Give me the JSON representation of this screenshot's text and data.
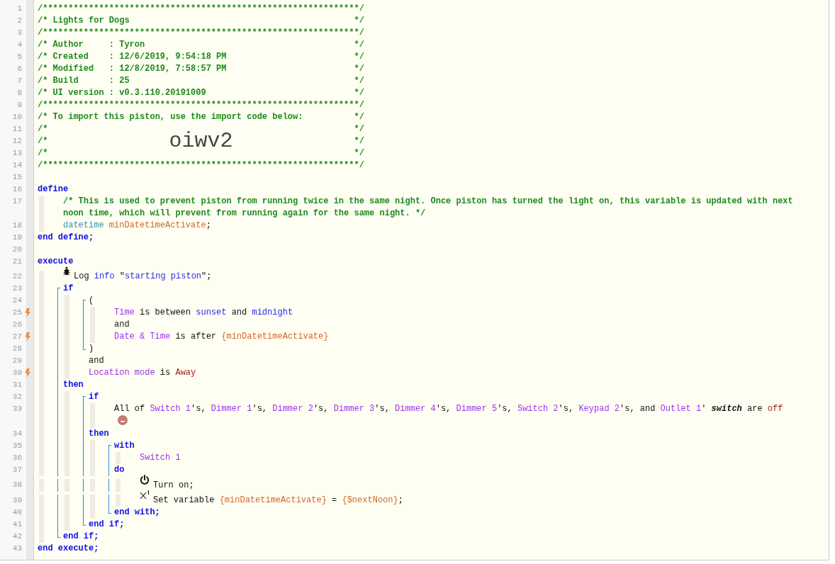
{
  "lines": [
    {
      "number": "1",
      "kind": "banner",
      "bolt": false,
      "bracket_open": false,
      "bracket_close": false,
      "tokens": [
        {
          "text": "/**************************************************************/",
          "kind": "comment"
        }
      ]
    },
    {
      "number": "2",
      "kind": "banner",
      "bolt": false,
      "bracket_open": false,
      "bracket_close": false,
      "tokens": [
        {
          "text": "/* Lights for Dogs",
          "kind": "comment"
        },
        {
          "text": "*/",
          "kind": "comment"
        }
      ]
    },
    {
      "number": "3",
      "kind": "banner",
      "bolt": false,
      "bracket_open": false,
      "bracket_close": false,
      "tokens": [
        {
          "text": "/**************************************************************/",
          "kind": "comment"
        }
      ]
    },
    {
      "number": "4",
      "kind": "banner",
      "bolt": false,
      "bracket_open": false,
      "bracket_close": false,
      "tokens": [
        {
          "text": "/* Author     : Tyron",
          "kind": "comment"
        },
        {
          "text": "*/",
          "kind": "comment"
        }
      ]
    },
    {
      "number": "5",
      "kind": "banner",
      "bolt": false,
      "bracket_open": false,
      "bracket_close": false,
      "tokens": [
        {
          "text": "/* Created    : 12/6/2019, 9:54:18 PM",
          "kind": "comment"
        },
        {
          "text": "*/",
          "kind": "comment"
        }
      ]
    },
    {
      "number": "6",
      "kind": "banner",
      "bolt": false,
      "bracket_open": false,
      "bracket_close": false,
      "tokens": [
        {
          "text": "/* Modified   : 12/8/2019, 7:58:57 PM",
          "kind": "comment"
        },
        {
          "text": "*/",
          "kind": "comment"
        }
      ]
    },
    {
      "number": "7",
      "kind": "banner",
      "bolt": false,
      "bracket_open": false,
      "bracket_close": false,
      "tokens": [
        {
          "text": "/* Build      : 25",
          "kind": "comment"
        },
        {
          "text": "*/",
          "kind": "comment"
        }
      ]
    },
    {
      "number": "8",
      "kind": "banner",
      "bolt": false,
      "bracket_open": false,
      "bracket_close": false,
      "tokens": [
        {
          "text": "/* UI version : v0.3.110.20191009",
          "kind": "comment"
        },
        {
          "text": "*/",
          "kind": "comment"
        }
      ]
    },
    {
      "number": "9",
      "kind": "banner",
      "bolt": false,
      "bracket_open": false,
      "bracket_close": false,
      "tokens": [
        {
          "text": "/**************************************************************/",
          "kind": "comment"
        }
      ]
    },
    {
      "number": "10",
      "kind": "banner",
      "bolt": false,
      "bracket_open": false,
      "bracket_close": false,
      "tokens": [
        {
          "text": "/* To import this piston, use the import code below:",
          "kind": "comment"
        },
        {
          "text": "*/",
          "kind": "comment"
        }
      ]
    },
    {
      "number": "11",
      "kind": "banner",
      "bolt": false,
      "bracket_open": false,
      "bracket_close": false,
      "tokens": [
        {
          "text": "/*",
          "kind": "comment"
        },
        {
          "text": "*/",
          "kind": "comment"
        }
      ]
    },
    {
      "number": "12",
      "kind": "banner",
      "bolt": false,
      "bracket_open": false,
      "bracket_close": false,
      "tokens": [
        {
          "text": "/*",
          "kind": "comment"
        },
        {
          "text": "oiwv2",
          "kind": "import-code"
        },
        {
          "text": "*/",
          "kind": "comment"
        }
      ]
    },
    {
      "number": "13",
      "kind": "banner",
      "bolt": false,
      "bracket_open": false,
      "bracket_close": false,
      "tokens": [
        {
          "text": "/*",
          "kind": "comment"
        },
        {
          "text": "*/",
          "kind": "comment"
        }
      ]
    },
    {
      "number": "14",
      "kind": "banner",
      "bolt": false,
      "bracket_open": false,
      "bracket_close": false,
      "tokens": [
        {
          "text": "/**************************************************************/",
          "kind": "comment"
        }
      ]
    },
    {
      "number": "15",
      "kind": "code",
      "bolt": false,
      "bracket_open": false,
      "bracket_close": false
    },
    {
      "number": "16",
      "kind": "code",
      "bolt": false,
      "bracket_open": false,
      "bracket_close": false,
      "tokens": [
        {
          "text": "define",
          "kind": "keyword"
        }
      ],
      "children": [
        {
          "number": "17",
          "kind": "code",
          "bolt": false,
          "bracket_open": false,
          "bracket_close": false,
          "tokens": [
            {
              "text": "/* This is used to prevent piston from running twice in the same night. Once piston has turned the light on, this variable is updated with next noon time, which will prevent from running again for the same night. */",
              "kind": "comment"
            }
          ]
        },
        {
          "number": "18",
          "kind": "code",
          "bolt": false,
          "bracket_open": false,
          "bracket_close": false,
          "tokens": [
            {
              "text": "datetime ",
              "kind": "type"
            },
            {
              "text": "minDatetimeActivate",
              "kind": "variable"
            },
            {
              "text": ";",
              "kind": "plain"
            }
          ]
        }
      ]
    },
    {
      "number": "19",
      "kind": "code",
      "bolt": false,
      "bracket_open": false,
      "bracket_close": false,
      "tokens": [
        {
          "text": "end define;",
          "kind": "keyword"
        }
      ]
    },
    {
      "number": "20",
      "kind": "code",
      "bolt": false,
      "bracket_open": false,
      "bracket_close": false
    },
    {
      "number": "21",
      "kind": "code",
      "bolt": false,
      "bracket_open": false,
      "bracket_close": false,
      "tokens": [
        {
          "text": "execute",
          "kind": "keyword"
        }
      ],
      "children": [
        {
          "number": "22",
          "kind": "log",
          "bolt": false,
          "bracket_open": false,
          "bracket_close": false,
          "tokens": [
            {
              "text": "Log ",
              "kind": "plain"
            },
            {
              "text": "info",
              "kind": "value"
            },
            {
              "text": " \"",
              "kind": "plain"
            },
            {
              "text": "starting piston",
              "kind": "value"
            },
            {
              "text": "\";",
              "kind": "plain"
            }
          ]
        },
        {
          "number": "23",
          "kind": "code",
          "bolt": false,
          "bracket_open": true,
          "bracket_close": false,
          "tokens": [
            {
              "text": "if",
              "kind": "keyword"
            }
          ],
          "children": [
            {
              "number": "24",
              "kind": "code",
              "bolt": false,
              "bracket_open": true,
              "bracket_close": false,
              "tokens": [
                {
                  "text": "(",
                  "kind": "plain"
                }
              ],
              "children": [
                {
                  "number": "25",
                  "kind": "code",
                  "bolt": true,
                  "bracket_open": false,
                  "bracket_close": false,
                  "tokens": [
                    {
                      "text": "Time",
                      "kind": "device"
                    },
                    {
                      "text": " is between ",
                      "kind": "plain"
                    },
                    {
                      "text": "sunset",
                      "kind": "value"
                    },
                    {
                      "text": " and ",
                      "kind": "plain"
                    },
                    {
                      "text": "midnight",
                      "kind": "value"
                    }
                  ]
                },
                {
                  "number": "26",
                  "kind": "code",
                  "bolt": false,
                  "bracket_open": false,
                  "bracket_close": false,
                  "tokens": [
                    {
                      "text": "and",
                      "kind": "plain"
                    }
                  ]
                },
                {
                  "number": "27",
                  "kind": "code",
                  "bolt": true,
                  "bracket_open": false,
                  "bracket_close": false,
                  "tokens": [
                    {
                      "text": "Date & Time",
                      "kind": "device"
                    },
                    {
                      "text": " is after ",
                      "kind": "plain"
                    },
                    {
                      "text": "{minDatetimeActivate}",
                      "kind": "variable"
                    }
                  ]
                }
              ]
            },
            {
              "number": "28",
              "kind": "code",
              "bolt": false,
              "bracket_open": false,
              "bracket_close": true,
              "tokens": [
                {
                  "text": ")",
                  "kind": "plain"
                }
              ]
            },
            {
              "number": "29",
              "kind": "code",
              "bolt": false,
              "bracket_open": false,
              "bracket_close": false,
              "tokens": [
                {
                  "text": "and",
                  "kind": "plain"
                }
              ]
            },
            {
              "number": "30",
              "kind": "code",
              "bolt": true,
              "bracket_open": false,
              "bracket_close": false,
              "tokens": [
                {
                  "text": "Location mode",
                  "kind": "device"
                },
                {
                  "text": " is ",
                  "kind": "plain"
                },
                {
                  "text": "Away",
                  "kind": "constant"
                }
              ]
            }
          ]
        },
        {
          "number": "31",
          "kind": "code",
          "bolt": false,
          "bracket_open": false,
          "bracket_close": false,
          "tokens": [
            {
              "text": "then",
              "kind": "keyword"
            }
          ],
          "children": [
            {
              "number": "32",
              "kind": "code",
              "bolt": false,
              "bracket_open": true,
              "bracket_close": false,
              "tokens": [
                {
                  "text": "if",
                  "kind": "keyword"
                }
              ],
              "children": [
                {
                  "number": "33",
                  "kind": "removable-condition",
                  "bolt": false,
                  "bracket_open": false,
                  "bracket_close": false,
                  "tokens": [
                    {
                      "text": "All of ",
                      "kind": "plain"
                    },
                    {
                      "text": "Switch 1",
                      "kind": "device"
                    },
                    {
                      "text": "'s, ",
                      "kind": "plain"
                    },
                    {
                      "text": "Dimmer 1",
                      "kind": "device"
                    },
                    {
                      "text": "'s, ",
                      "kind": "plain"
                    },
                    {
                      "text": "Dimmer 2",
                      "kind": "device"
                    },
                    {
                      "text": "'s, ",
                      "kind": "plain"
                    },
                    {
                      "text": "Dimmer 3",
                      "kind": "device"
                    },
                    {
                      "text": "'s, ",
                      "kind": "plain"
                    },
                    {
                      "text": "Dimmer 4",
                      "kind": "device"
                    },
                    {
                      "text": "'s, ",
                      "kind": "plain"
                    },
                    {
                      "text": "Dimmer 5",
                      "kind": "device"
                    },
                    {
                      "text": "'s, ",
                      "kind": "plain"
                    },
                    {
                      "text": "Switch 2",
                      "kind": "device"
                    },
                    {
                      "text": "'s, ",
                      "kind": "plain"
                    },
                    {
                      "text": "Keypad 2",
                      "kind": "device"
                    },
                    {
                      "text": "'s, and ",
                      "kind": "plain"
                    },
                    {
                      "text": "Outlet 1",
                      "kind": "device"
                    },
                    {
                      "text": "' ",
                      "kind": "plain"
                    },
                    {
                      "text": "switch",
                      "kind": "emphasis"
                    },
                    {
                      "text": " are ",
                      "kind": "plain"
                    },
                    {
                      "text": "off",
                      "kind": "constant"
                    }
                  ]
                }
              ]
            },
            {
              "number": "34",
              "kind": "code",
              "bolt": false,
              "bracket_open": false,
              "bracket_close": false,
              "tokens": [
                {
                  "text": "then",
                  "kind": "keyword"
                }
              ],
              "children": [
                {
                  "number": "35",
                  "kind": "code",
                  "bolt": false,
                  "bracket_open": true,
                  "bracket_close": false,
                  "tokens": [
                    {
                      "text": "with",
                      "kind": "keyword"
                    }
                  ],
                  "children": [
                    {
                      "number": "36",
                      "kind": "code",
                      "bolt": false,
                      "bracket_open": false,
                      "bracket_close": false,
                      "tokens": [
                        {
                          "text": "Switch 1",
                          "kind": "device"
                        }
                      ]
                    }
                  ]
                },
                {
                  "number": "37",
                  "kind": "code",
                  "bolt": false,
                  "bracket_open": false,
                  "bracket_close": false,
                  "tokens": [
                    {
                      "text": "do",
                      "kind": "keyword"
                    }
                  ],
                  "children": [
                    {
                      "number": "38",
                      "kind": "command",
                      "bolt": false,
                      "bracket_open": false,
                      "bracket_close": false,
                      "tokens": [
                        {
                          "text": "Turn on;",
                          "kind": "plain"
                        }
                      ]
                    },
                    {
                      "number": "39",
                      "kind": "assignment",
                      "bolt": false,
                      "bracket_open": false,
                      "bracket_close": false,
                      "tokens": [
                        {
                          "text": "Set variable ",
                          "kind": "plain"
                        },
                        {
                          "text": "{minDatetimeActivate}",
                          "kind": "variable"
                        },
                        {
                          "text": " = ",
                          "kind": "plain"
                        },
                        {
                          "text": "{$nextNoon}",
                          "kind": "variable"
                        },
                        {
                          "text": ";",
                          "kind": "plain"
                        }
                      ]
                    }
                  ]
                },
                {
                  "number": "40",
                  "kind": "code",
                  "bolt": false,
                  "bracket_open": false,
                  "bracket_close": true,
                  "tokens": [
                    {
                      "text": "end with;",
                      "kind": "keyword"
                    }
                  ]
                }
              ]
            },
            {
              "number": "41",
              "kind": "code",
              "bolt": false,
              "bracket_open": false,
              "bracket_close": true,
              "tokens": [
                {
                  "text": "end if;",
                  "kind": "keyword"
                }
              ]
            }
          ]
        },
        {
          "number": "42",
          "kind": "code",
          "bolt": false,
          "bracket_open": false,
          "bracket_close": true,
          "tokens": [
            {
              "text": "end if;",
              "kind": "keyword"
            }
          ]
        }
      ]
    },
    {
      "number": "43",
      "kind": "code",
      "bolt": false,
      "bracket_open": false,
      "bracket_close": false,
      "tokens": [
        {
          "text": "end execute;",
          "kind": "keyword"
        }
      ]
    }
  ]
}
